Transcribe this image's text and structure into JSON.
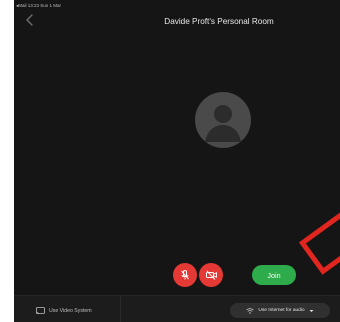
{
  "status_bar": {
    "text": "◂Mail  13:23  Sun 1 Mar"
  },
  "header": {
    "title": "Davide Proft's Personal Room",
    "back_icon": "chevron-left-icon"
  },
  "avatar": {
    "icon": "person-icon"
  },
  "controls": {
    "mute_icon": "mic-off-icon",
    "video_icon": "video-off-icon",
    "join_label": "Join",
    "danger_color": "#e53935",
    "join_color": "#2eab4a"
  },
  "bottom_bar": {
    "video_system_label": "Use Video System",
    "video_system_icon": "cast-icon",
    "audio_label": "Use Internet for audio",
    "audio_icon": "wifi-icon",
    "audio_dropdown_icon": "caret-down-icon"
  },
  "annotation": {
    "color": "#e0261f"
  }
}
